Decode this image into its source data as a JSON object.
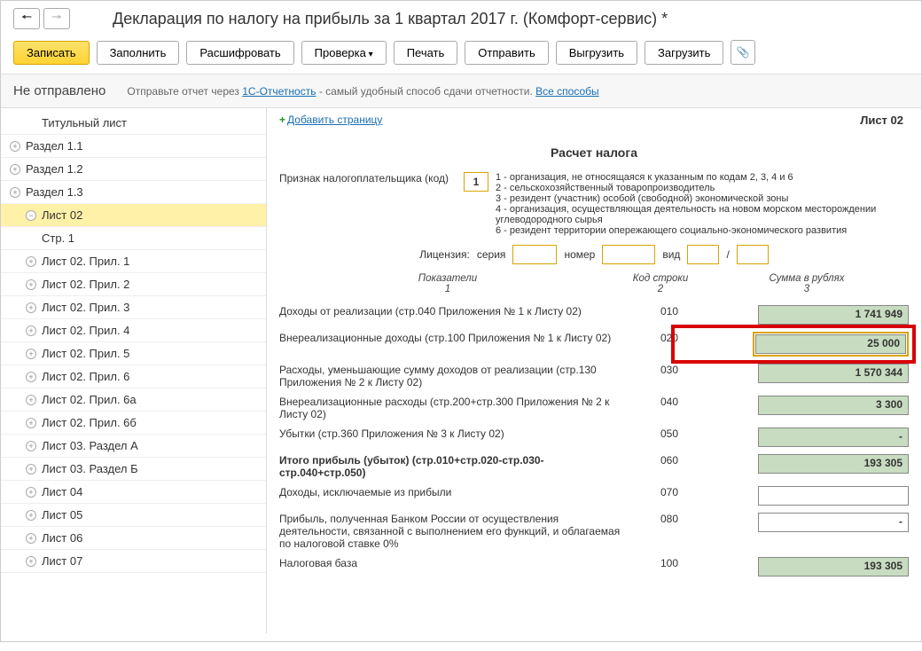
{
  "header": {
    "title": "Декларация по налогу на прибыль за 1 квартал 2017 г. (Комфорт-сервис) *"
  },
  "toolbar": {
    "write": "Записать",
    "fill": "Заполнить",
    "decrypt": "Расшифровать",
    "check": "Проверка",
    "print": "Печать",
    "send": "Отправить",
    "export": "Выгрузить",
    "import": "Загрузить"
  },
  "status": {
    "label": "Не отправлено",
    "hint_pre": "Отправьте отчет через ",
    "hint_link": "1С-Отчетность",
    "hint_post": " - самый удобный способ сдачи отчетности. ",
    "all_link": "Все способы"
  },
  "tree": [
    {
      "label": "Титульный лист",
      "noexp": true
    },
    {
      "label": "Раздел 1.1"
    },
    {
      "label": "Раздел 1.2"
    },
    {
      "label": "Раздел 1.3"
    },
    {
      "label": "Лист 02",
      "selected": true,
      "expanded": true,
      "level": 2
    },
    {
      "label": "Стр. 1",
      "level": 3,
      "noexp": true
    },
    {
      "label": "Лист 02. Прил. 1",
      "level": 2
    },
    {
      "label": "Лист 02. Прил. 2",
      "level": 2
    },
    {
      "label": "Лист 02. Прил. 3",
      "level": 2
    },
    {
      "label": "Лист 02. Прил. 4",
      "level": 2
    },
    {
      "label": "Лист 02. Прил. 5",
      "level": 2
    },
    {
      "label": "Лист 02. Прил. 6",
      "level": 2
    },
    {
      "label": "Лист 02. Прил. 6а",
      "level": 2
    },
    {
      "label": "Лист 02. Прил. 6б",
      "level": 2
    },
    {
      "label": "Лист 03. Раздел А",
      "level": 2
    },
    {
      "label": "Лист 03. Раздел Б",
      "level": 2
    },
    {
      "label": "Лист 04",
      "level": 2
    },
    {
      "label": "Лист 05",
      "level": 2
    },
    {
      "label": "Лист 06",
      "level": 2
    },
    {
      "label": "Лист 07",
      "level": 2
    }
  ],
  "content": {
    "add_page": "Добавить страницу",
    "sheet_label": "Лист 02",
    "sheet_title": "Расчет налога",
    "taxpayer_label": "Признак налогоплательщика (код)",
    "taxpayer_code": "1",
    "expl": [
      "1 - организация, не относящаяся к указанным по кодам 2, 3, 4 и 6",
      "2 - сельскохозяйственный товаропроизводитель",
      "3 - резидент (участник) особой (свободной) экономической зоны",
      "4 - организация, осуществляющая деятельность на новом морском месторождении углеводородного сырья",
      "6 - резидент территории опережающего социально-экономического развития"
    ],
    "license": {
      "label": "Лицензия:",
      "series": "серия",
      "number": "номер",
      "type": "вид",
      "slash": "/"
    },
    "cols": {
      "c1a": "Показатели",
      "c1b": "1",
      "c2a": "Код строки",
      "c2b": "2",
      "c3a": "Сумма в рублях",
      "c3b": "3"
    },
    "rows": [
      {
        "indicator": "Доходы от реализации (стр.040 Приложения № 1 к Листу 02)",
        "code": "010",
        "amount": "1 741 949",
        "type": "green"
      },
      {
        "indicator": "Внереализационные доходы (стр.100 Приложения № 1 к Листу 02)",
        "code": "020",
        "amount": "25 000",
        "type": "green",
        "highlight": true
      },
      {
        "indicator": "Расходы, уменьшающие сумму доходов от реализации (стр.130 Приложения № 2 к Листу 02)",
        "code": "030",
        "amount": "1 570 344",
        "type": "green"
      },
      {
        "indicator": "Внереализационные расходы (стр.200+стр.300 Приложения № 2 к Листу 02)",
        "code": "040",
        "amount": "3 300",
        "type": "green"
      },
      {
        "indicator": "Убытки (стр.360 Приложения № 3 к Листу 02)",
        "code": "050",
        "amount": "-",
        "type": "dash"
      },
      {
        "indicator": "Итого прибыль (убыток)   (стр.010+стр.020-стр.030-стр.040+стр.050)",
        "code": "060",
        "amount": "193 305",
        "type": "green",
        "bold": true
      },
      {
        "indicator": "Доходы, исключаемые из прибыли",
        "code": "070",
        "amount": "",
        "type": "empty"
      },
      {
        "indicator": "Прибыль, полученная Банком России от осуществления деятельности, связанной с выполнением его функций, и облагаемая по налоговой ставке 0%",
        "code": "080",
        "amount": "-",
        "type": "empty"
      },
      {
        "indicator": "Налоговая база",
        "code": "100",
        "amount": "193 305",
        "type": "green"
      }
    ]
  }
}
